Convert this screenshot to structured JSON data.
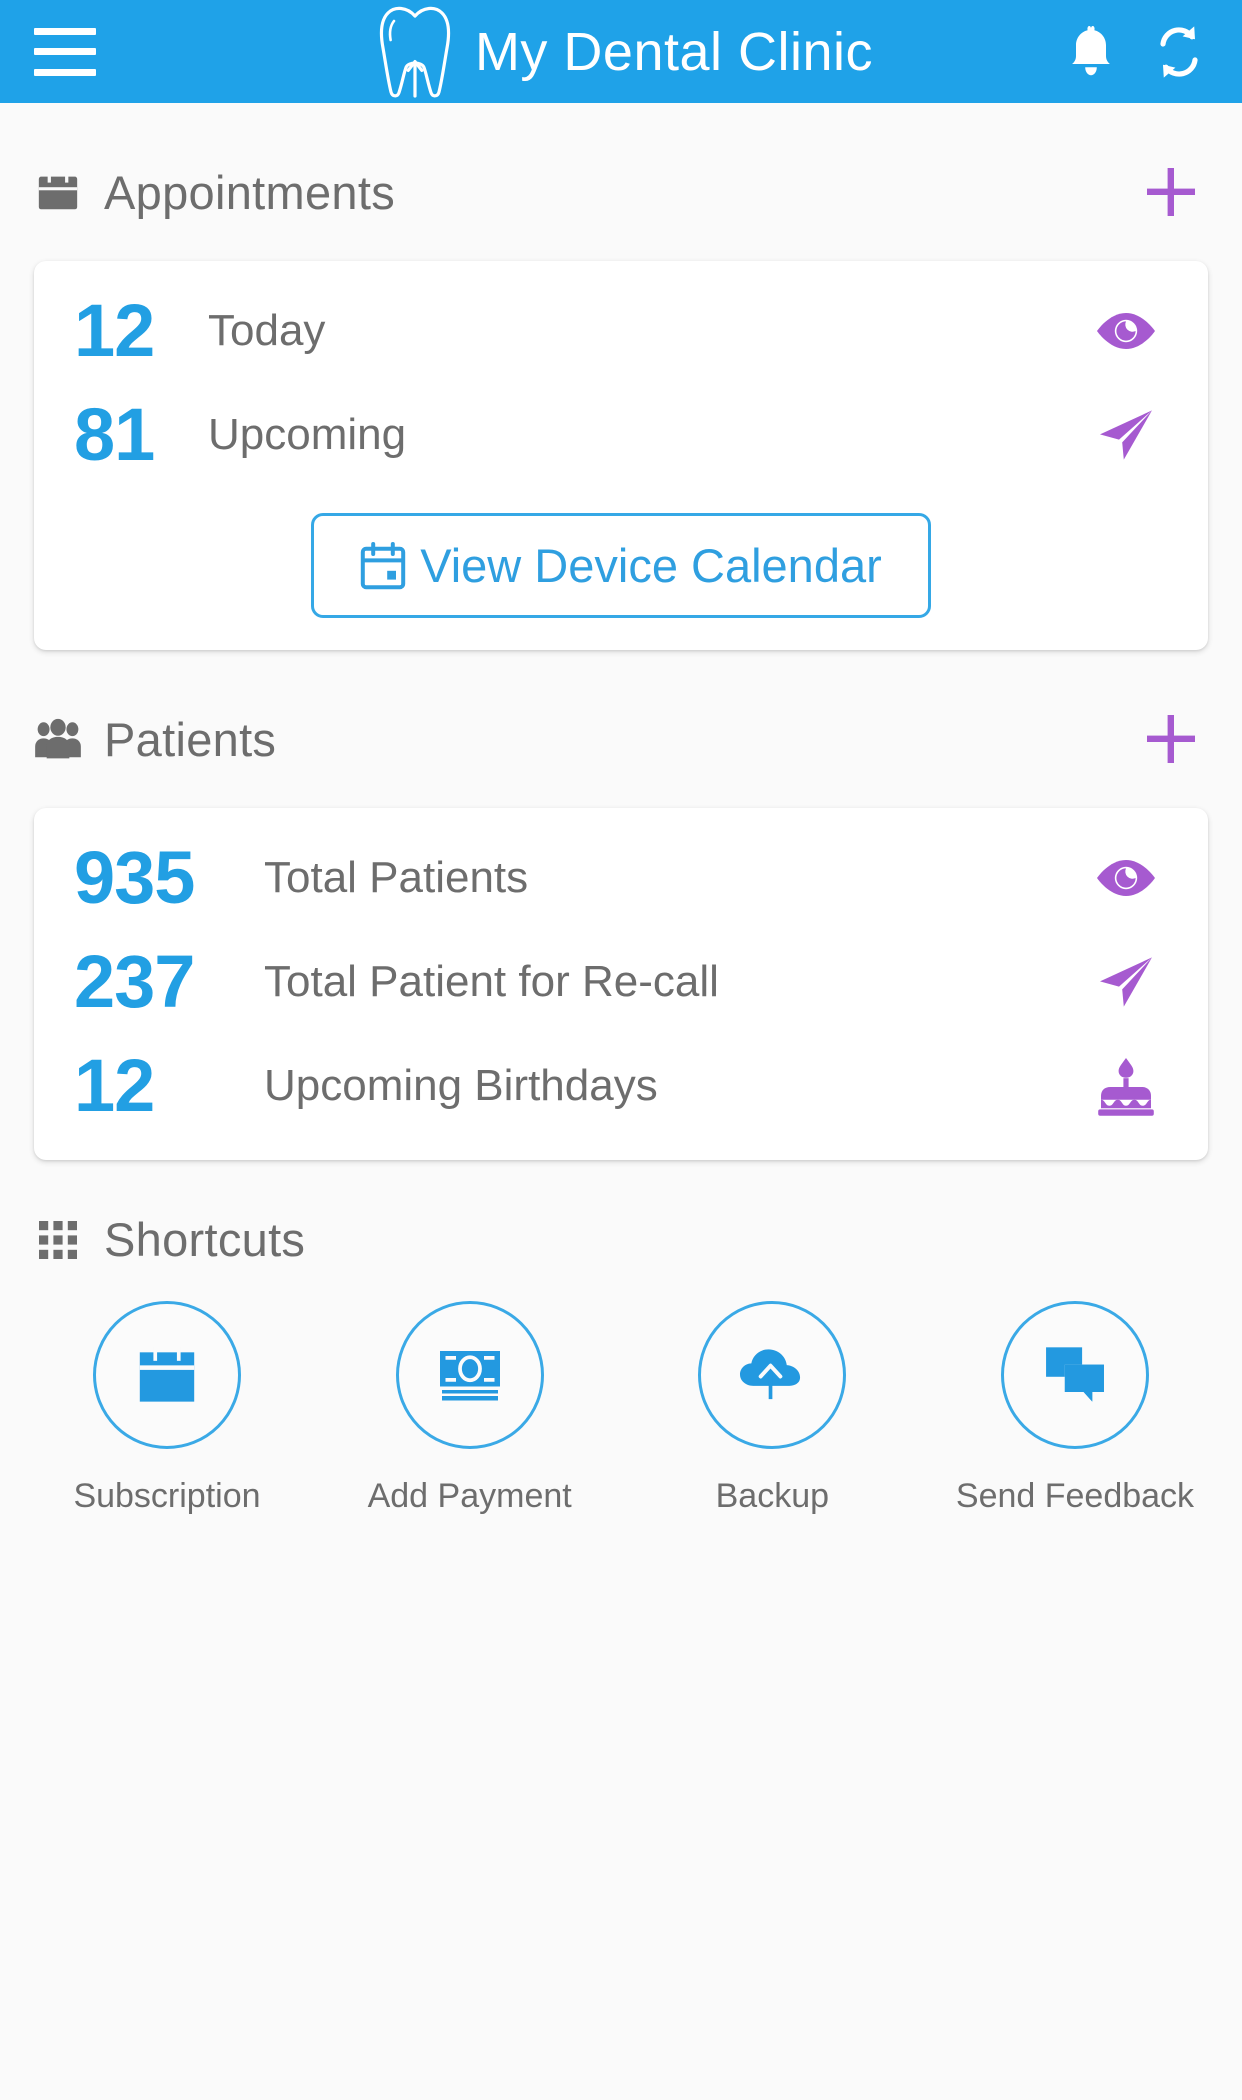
{
  "header": {
    "title": "My Dental Clinic",
    "menu_icon": "hamburger-menu-icon",
    "logo_icon": "tooth-logo-icon",
    "notification_icon": "bell-icon",
    "sync_icon": "sync-refresh-icon",
    "background_color": "#1fa2e8"
  },
  "colors": {
    "accent_blue": "#229fe3",
    "accent_purple": "#a65ad0",
    "label_gray": "#6d6d6d",
    "page_bg": "#fafafa",
    "card_bg": "#ffffff"
  },
  "appointments": {
    "section_title": "Appointments",
    "section_icon": "calendar-icon",
    "add_label": "+",
    "stats": [
      {
        "value": "12",
        "label": "Today",
        "action_icon": "eye-icon"
      },
      {
        "value": "81",
        "label": "Upcoming",
        "action_icon": "send-icon"
      }
    ],
    "calendar_button": {
      "label": "View Device Calendar",
      "icon": "calendar-outline-icon"
    }
  },
  "patients": {
    "section_title": "Patients",
    "section_icon": "people-group-icon",
    "add_label": "+",
    "stats": [
      {
        "value": "935",
        "label": "Total Patients",
        "action_icon": "eye-icon"
      },
      {
        "value": "237",
        "label": "Total Patient for Re-call",
        "action_icon": "send-icon"
      },
      {
        "value": "12",
        "label": "Upcoming Birthdays",
        "action_icon": "birthday-cake-icon"
      }
    ]
  },
  "shortcuts": {
    "section_title": "Shortcuts",
    "section_icon": "grid-dots-icon",
    "items": [
      {
        "label": "Subscription",
        "icon": "calendar-filled-icon"
      },
      {
        "label": "Add Payment",
        "icon": "banknote-icon"
      },
      {
        "label": "Backup",
        "icon": "cloud-upload-icon"
      },
      {
        "label": "Send Feedback",
        "icon": "chat-bubbles-icon"
      }
    ]
  }
}
